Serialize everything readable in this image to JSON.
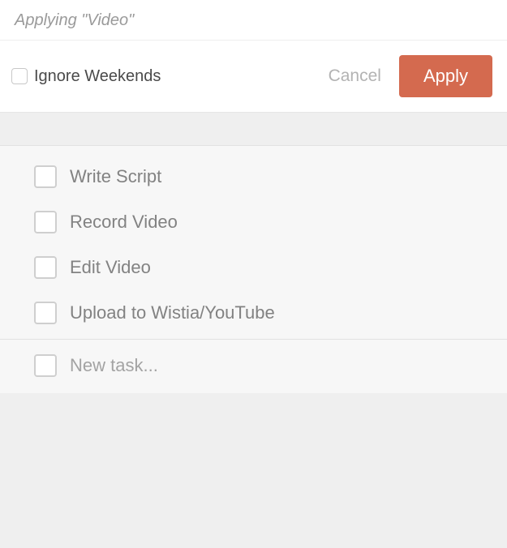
{
  "header": {
    "title": "Applying \"Video\""
  },
  "toolbar": {
    "ignore_weekends_label": "Ignore Weekends",
    "cancel_label": "Cancel",
    "apply_label": "Apply"
  },
  "tasks": {
    "items": [
      {
        "label": "Write Script"
      },
      {
        "label": "Record Video"
      },
      {
        "label": "Edit Video"
      },
      {
        "label": "Upload to Wistia/YouTube"
      }
    ],
    "new_task_placeholder": "New task..."
  }
}
